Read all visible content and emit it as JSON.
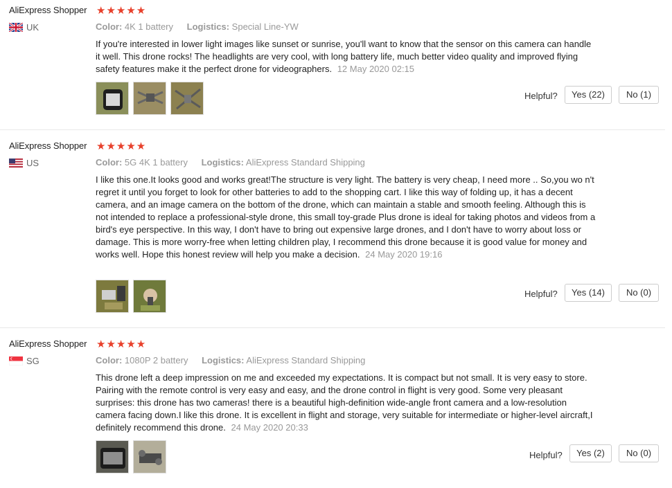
{
  "reviews": [
    {
      "user": "AliExpress Shopper",
      "stars": "★★★★★",
      "country": "UK",
      "color_label": "Color:",
      "color_value": "4K 1 battery",
      "logistics_label": "Logistics:",
      "logistics_value": "Special Line-YW",
      "text": "If you're interested in lower light images like sunset or sunrise, you'll want to know that the sensor on this camera can handle it well. This drone rocks! The headlights are very cool, with long battery life, much better video quality and improved flying safety features make it the perfect drone for videographers.",
      "date": "12 May 2020 02:15",
      "helpful": "Helpful?",
      "yes": "Yes (22)",
      "no": "No (1)"
    },
    {
      "user": "AliExpress Shopper",
      "stars": "★★★★★",
      "country": "US",
      "color_label": "Color:",
      "color_value": "5G 4K 1 battery",
      "logistics_label": "Logistics:",
      "logistics_value": "AliExpress Standard Shipping",
      "text": "I like this one.It looks good and works great!The structure is very light. The battery is very cheap, I need more .. So,you wo n't regret it until you forget to look for other batteries to add to the shopping cart. I like this way of folding up, it has a decent camera, and an image camera on the bottom of the drone, which can maintain a stable and smooth feeling. Although this is not intended to replace a professional-style drone, this small toy-grade Plus drone is ideal for taking photos and videos from a bird's eye perspective. In this way, I don't have to bring out expensive large drones, and I don't have to worry about loss or damage. This is more worry-free when letting children play, I recommend this drone because it is good value for money and works well. Hope this honest review will help you make a decision.",
      "date": "24 May 2020 19:16",
      "helpful": "Helpful?",
      "yes": "Yes (14)",
      "no": "No (0)"
    },
    {
      "user": "AliExpress Shopper",
      "stars": "★★★★★",
      "country": "SG",
      "color_label": "Color:",
      "color_value": "1080P 2 battery",
      "logistics_label": "Logistics:",
      "logistics_value": "AliExpress Standard Shipping",
      "text": "This drone left a deep impression on me and exceeded my expectations. It is compact but not small. It is very easy to store. Pairing with the remote control is very easy and easy, and the drone control in flight is very good. Some very pleasant surprises: this drone has two cameras! there is a beautiful high-definition wide-angle front camera and a low-resolution camera facing down.I like this drone. It is excellent in flight and storage, very suitable for intermediate or higher-level aircraft,I definitely recommend this drone.",
      "date": "24 May 2020 20:33",
      "helpful": "Helpful?",
      "yes": "Yes (2)",
      "no": "No (0)"
    }
  ],
  "colors": {
    "star": "#e8402b",
    "meta": "#999999",
    "text": "#222222"
  }
}
